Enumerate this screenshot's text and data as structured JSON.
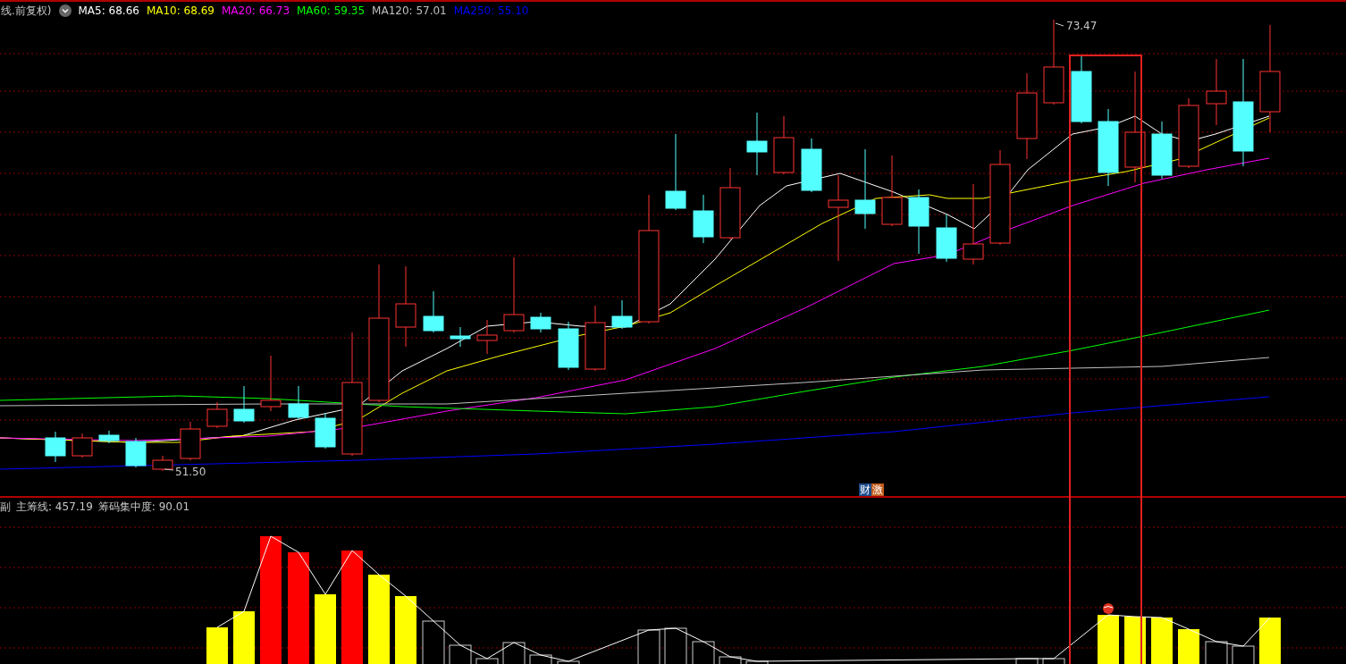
{
  "price_panel": {
    "legend": {
      "title": "线.前复权)",
      "items": [
        {
          "label": "MA5: 68.66",
          "color": "#ffffff"
        },
        {
          "label": "MA10: 68.69",
          "color": "#ffff00"
        },
        {
          "label": "MA20: 66.73",
          "color": "#ff00ff"
        },
        {
          "label": "MA60: 59.35",
          "color": "#00ff00"
        },
        {
          "label": "MA120: 57.01",
          "color": "#c0c0c0"
        },
        {
          "label": "MA250: 55.10",
          "color": "#0000ff"
        }
      ]
    },
    "high_label": "73.47",
    "low_label": "51.50",
    "badges": [
      {
        "text": "财",
        "color": "#1a4a8a"
      },
      {
        "text": "激",
        "color": "#c05a1a"
      }
    ]
  },
  "indicator_panel": {
    "legend": [
      "副",
      "主筹线: 457.19",
      "筹码集中度: 90.01"
    ]
  }
}
